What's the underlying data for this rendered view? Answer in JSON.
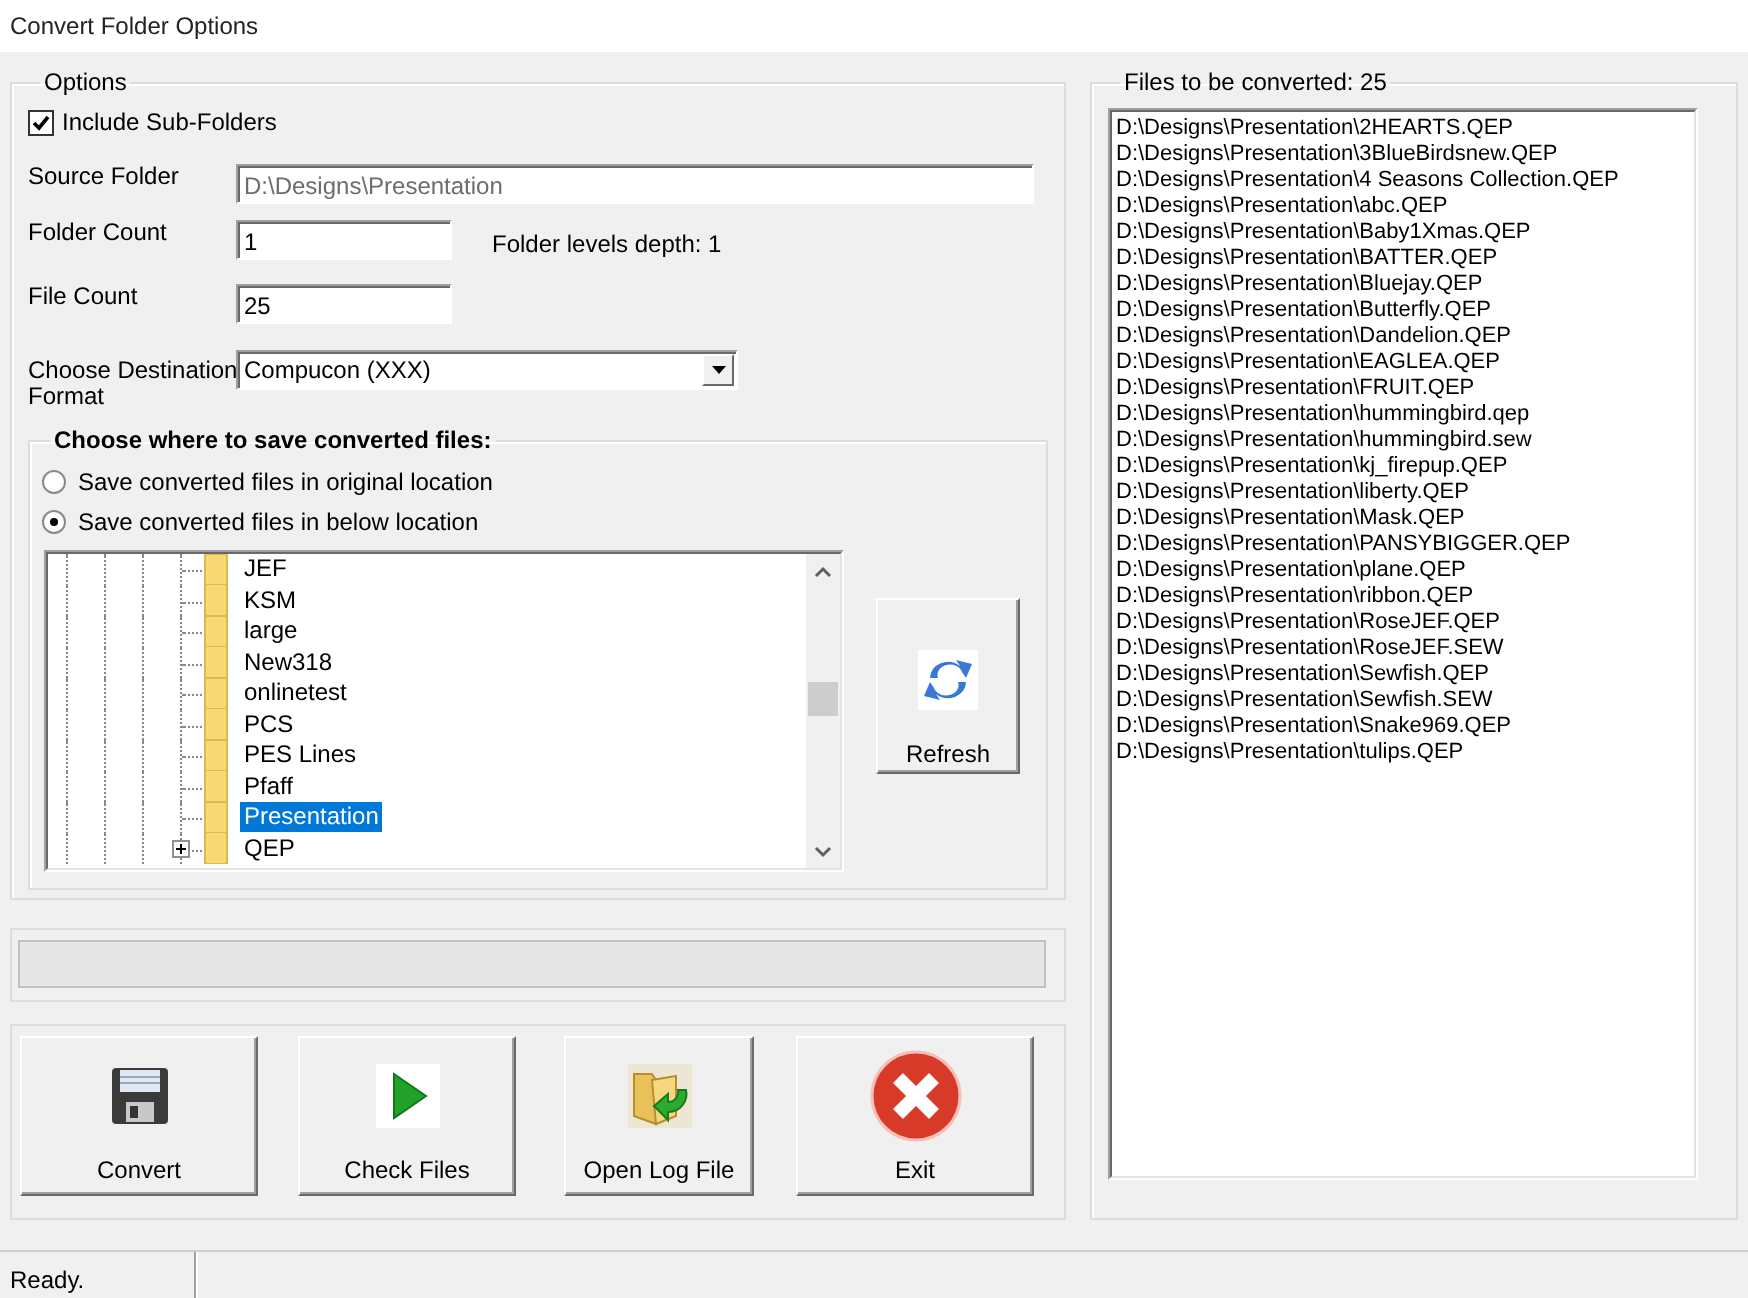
{
  "window": {
    "title": "Convert Folder Options"
  },
  "options": {
    "title": "Options",
    "include_subfolders": {
      "label": "Include Sub-Folders",
      "checked": true
    },
    "source_folder": {
      "label": "Source Folder",
      "value": "D:\\Designs\\Presentation",
      "disabled": true
    },
    "folder_count": {
      "label": "Folder Count",
      "value": "1"
    },
    "folder_depth": "Folder levels depth: 1",
    "file_count": {
      "label": "File Count",
      "value": "25"
    },
    "destination_format": {
      "label": "Choose Destination Format",
      "value": "Compucon (XXX)"
    },
    "save_location": {
      "title": "Choose where to save converted files:",
      "choices": [
        {
          "label": "Save converted files in original location",
          "selected": false
        },
        {
          "label": "Save converted files in below location",
          "selected": true
        }
      ],
      "tree": [
        {
          "label": "JEF",
          "selected": false,
          "expandable": false
        },
        {
          "label": "KSM",
          "selected": false,
          "expandable": false
        },
        {
          "label": "large",
          "selected": false,
          "expandable": false
        },
        {
          "label": "New318",
          "selected": false,
          "expandable": false
        },
        {
          "label": "onlinetest",
          "selected": false,
          "expandable": false
        },
        {
          "label": "PCS",
          "selected": false,
          "expandable": false
        },
        {
          "label": "PES Lines",
          "selected": false,
          "expandable": false
        },
        {
          "label": "Pfaff",
          "selected": false,
          "expandable": false
        },
        {
          "label": "Presentation",
          "selected": true,
          "expandable": false
        },
        {
          "label": "QEP",
          "selected": false,
          "expandable": true
        }
      ],
      "refresh_button": "Refresh"
    }
  },
  "buttons": [
    {
      "kind": "save",
      "label": "Convert"
    },
    {
      "kind": "play",
      "label": "Check Files"
    },
    {
      "kind": "log",
      "label": "Open Log File"
    },
    {
      "kind": "exit",
      "label": "Exit"
    }
  ],
  "files": {
    "title": "Files to be converted: 25",
    "items": [
      "D:\\Designs\\Presentation\\2HEARTS.QEP",
      "D:\\Designs\\Presentation\\3BlueBirdsnew.QEP",
      "D:\\Designs\\Presentation\\4 Seasons Collection.QEP",
      "D:\\Designs\\Presentation\\abc.QEP",
      "D:\\Designs\\Presentation\\Baby1Xmas.QEP",
      "D:\\Designs\\Presentation\\BATTER.QEP",
      "D:\\Designs\\Presentation\\Bluejay.QEP",
      "D:\\Designs\\Presentation\\Butterfly.QEP",
      "D:\\Designs\\Presentation\\Dandelion.QEP",
      "D:\\Designs\\Presentation\\EAGLEA.QEP",
      "D:\\Designs\\Presentation\\FRUIT.QEP",
      "D:\\Designs\\Presentation\\hummingbird.qep",
      "D:\\Designs\\Presentation\\hummingbird.sew",
      "D:\\Designs\\Presentation\\kj_firepup.QEP",
      "D:\\Designs\\Presentation\\liberty.QEP",
      "D:\\Designs\\Presentation\\Mask.QEP",
      "D:\\Designs\\Presentation\\PANSYBIGGER.QEP",
      "D:\\Designs\\Presentation\\plane.QEP",
      "D:\\Designs\\Presentation\\ribbon.QEP",
      "D:\\Designs\\Presentation\\RoseJEF.QEP",
      "D:\\Designs\\Presentation\\RoseJEF.SEW",
      "D:\\Designs\\Presentation\\Sewfish.QEP",
      "D:\\Designs\\Presentation\\Sewfish.SEW",
      "D:\\Designs\\Presentation\\Snake969.QEP",
      "D:\\Designs\\Presentation\\tulips.QEP"
    ]
  },
  "progress": {
    "level": 0
  },
  "status_bar": {
    "text": "Ready."
  }
}
